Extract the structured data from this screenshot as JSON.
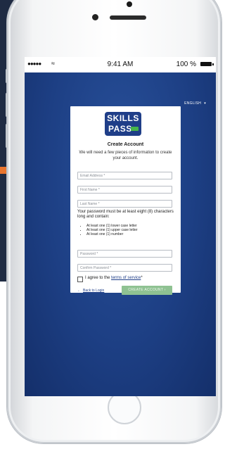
{
  "status_bar": {
    "signal": "●●●●●",
    "wifi": "≈",
    "time": "9:41 AM",
    "battery": "100 %"
  },
  "header": {
    "language": "ENGLISH",
    "language_chevron": "▾"
  },
  "logo": {
    "line1": "SKILLS",
    "line2": "PASS"
  },
  "form": {
    "title": "Create Account",
    "subtitle": "We will need a few pieces of information to create your account.",
    "email_placeholder": "Email Address *",
    "first_name_placeholder": "First Name *",
    "last_name_placeholder": "Last Name *",
    "password_rules_intro": "Your password must be at least eight (8) characters long and contain:",
    "password_rules": [
      "At least one (1) lower case letter",
      "At least one (1) upper case letter",
      "At least one (1) number"
    ],
    "password_placeholder": "Password *",
    "confirm_password_placeholder": "Confirm Password *",
    "agree_prefix": "I agree to the ",
    "agree_link": "terms of service",
    "agree_suffix": "*",
    "back_arrow": "←",
    "back_label": "Back to Login",
    "create_button": "CREATE ACCOUNT ›"
  },
  "colors": {
    "app_background": "#1d3f84",
    "brand_blue": "#1f3e88",
    "brand_green": "#46b54a",
    "button_disabled_green": "#8fc292",
    "accent_orange": "#e9752f"
  }
}
